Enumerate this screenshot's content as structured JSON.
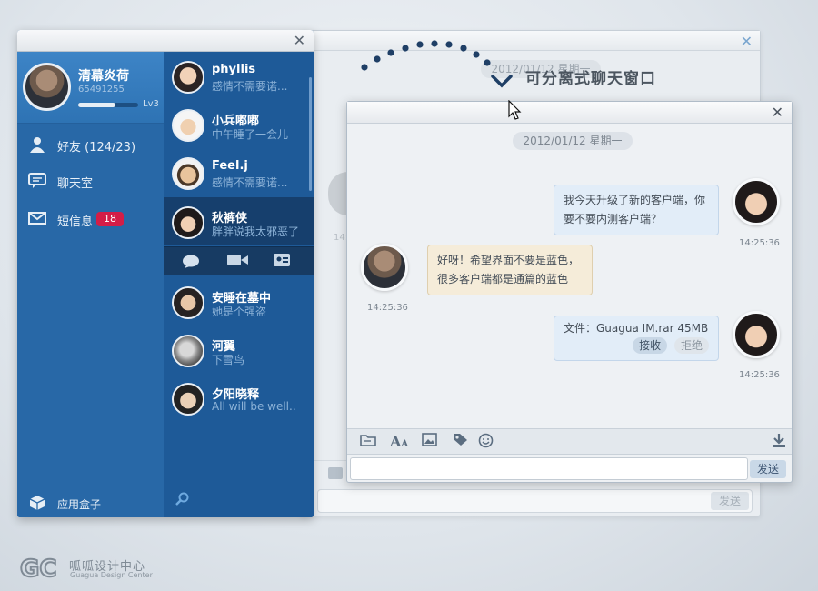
{
  "caption": "可分离式聊天窗口",
  "ghost_window": {
    "date": "2012/01/12 星期一",
    "send_label": "发送",
    "time": "14:"
  },
  "panel": {
    "profile": {
      "name": "清幕炎荷",
      "id": "65491255",
      "level": "Lv3",
      "level_progress": 0.62
    },
    "nav": [
      {
        "label": "好友 (124/23)",
        "icon": "friends-icon"
      },
      {
        "label": "聊天室",
        "icon": "chatroom-icon"
      },
      {
        "label": "短信息",
        "icon": "mail-icon",
        "badge": "18"
      }
    ],
    "app_box": "应用盒子",
    "contacts": [
      {
        "name": "phyllis",
        "msg": "感情不需要诺..."
      },
      {
        "name": "小兵嘟嘟",
        "msg": "中午睡了一会儿"
      },
      {
        "name": "Feel.j",
        "msg": "感情不需要诺..."
      },
      {
        "name": "秋裤侠",
        "msg": "胖胖说我太邪恶了",
        "selected": true
      },
      {
        "name": "安睡在墓中",
        "msg": "她是个强盗"
      },
      {
        "name": "河翼",
        "msg": "下雪鸟"
      },
      {
        "name": "夕阳晓释",
        "msg": "All will be well.."
      }
    ]
  },
  "chat": {
    "date": "2012/01/12  星期一",
    "messages": [
      {
        "from": "me",
        "lines": [
          "我今天升级了新的客户端，你",
          "要不要内测客户端？"
        ],
        "time": "14:25:36"
      },
      {
        "from": "them",
        "lines": [
          "好呀！希望界面不要是蓝色，",
          "很多客户端都是通篇的蓝色"
        ],
        "time": "14:25:36"
      },
      {
        "from": "me",
        "file": "文件：Guagua IM.rar 45MB",
        "accept": "接收",
        "reject": "拒绝",
        "time": "14:25:36"
      }
    ],
    "send_label": "发送"
  },
  "logo": {
    "cn": "呱呱设计中心",
    "en": "Guagua Design Center"
  }
}
